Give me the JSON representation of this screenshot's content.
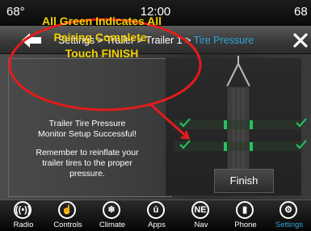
{
  "status": {
    "temp_left": "68°",
    "time": "12:00",
    "temp_right": "68"
  },
  "header": {
    "crumb_settings": "Settings",
    "crumb_sep1": " > ",
    "crumb_trailer": "Trailer",
    "crumb_sep2": " > ",
    "crumb_trailer1": "Trailer 1",
    "crumb_sep3": " > ",
    "crumb_active": "Tire Pressure"
  },
  "callout": {
    "line1": "All Green Indicates All",
    "line2": "Pairing Complete.",
    "line3": "Touch FINISH"
  },
  "main": {
    "success_line1": "Trailer Tire Pressure",
    "success_line2": "Monitor Setup Successful!",
    "reminder_line1": "Remember to reinflate your",
    "reminder_line2": "trailer tires to the proper",
    "reminder_line3": "pressure.",
    "finish_label": "Finish"
  },
  "nav": {
    "radio": "Radio",
    "controls": "Controls",
    "climate": "Climate",
    "apps": "Apps",
    "nav_label": "Nav",
    "nav_icon": "NE",
    "phone": "Phone",
    "settings": "Settings"
  },
  "colors": {
    "accent": "#2ea6d8",
    "callout": "#e31b1b",
    "callout_text": "#f1d000",
    "ok": "#22c55e"
  }
}
